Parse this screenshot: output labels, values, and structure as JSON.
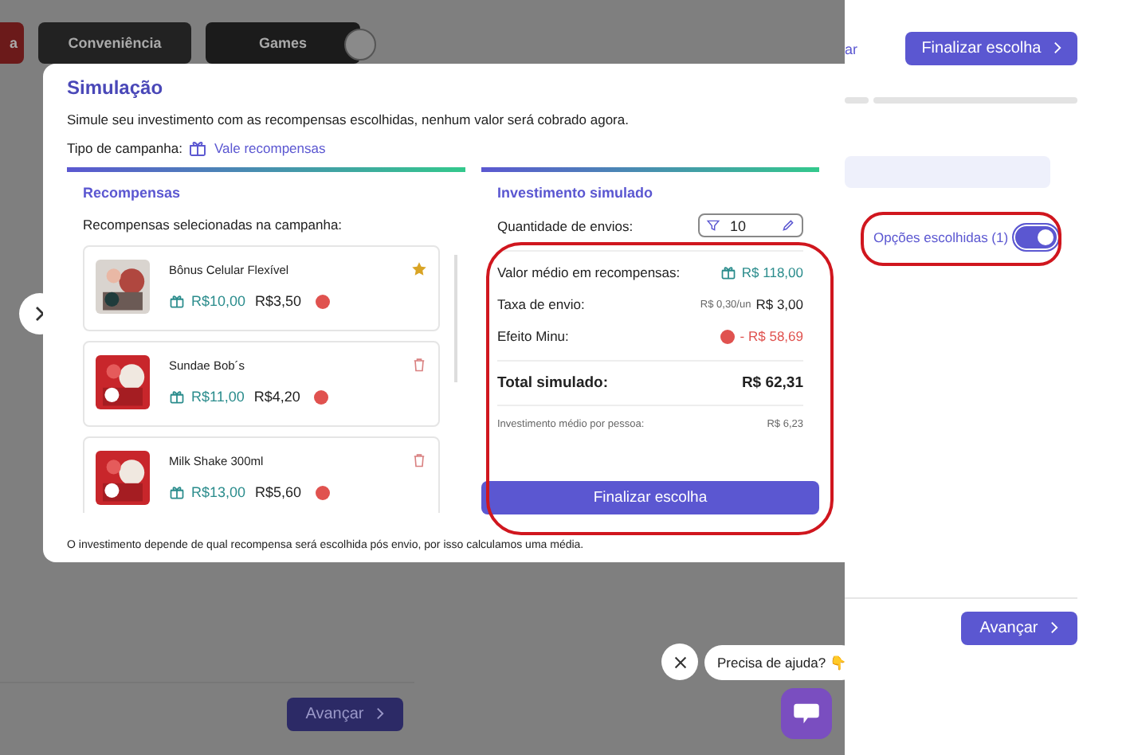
{
  "background": {
    "categories": [
      {
        "label": "a"
      },
      {
        "label": "Conveniência"
      },
      {
        "label": "Games"
      }
    ],
    "advance_button": "Avançar"
  },
  "side_panel": {
    "link": "ar",
    "finish_button": "Finalizar escolha",
    "toggle": {
      "label": "Opções escolhidas (1)",
      "on": true
    },
    "advance_button": "Avançar"
  },
  "modal": {
    "title": "Simulação",
    "subtitle": "Simule seu investimento com as recompensas escolhidas, nenhum valor será cobrado agora.",
    "campaign_type_label": "Tipo de campanha:",
    "campaign_type": "Vale recompensas",
    "rewards": {
      "title": "Recompensas",
      "caption": "Recompensas selecionadas na campanha:",
      "items": [
        {
          "name": "Bônus Celular Flexível",
          "value": "R$10,00",
          "cost": "R$3,50",
          "featured": true
        },
        {
          "name": "Sundae Bob´s",
          "value": "R$11,00",
          "cost": "R$4,20",
          "featured": false
        },
        {
          "name": "Milk Shake 300ml",
          "value": "R$13,00",
          "cost": "R$5,60",
          "featured": false
        }
      ]
    },
    "investment": {
      "title": "Investimento simulado",
      "quantity_label": "Quantidade de envios:",
      "quantity": "10",
      "rows": [
        {
          "label": "Valor médio em recompensas:",
          "value": "R$ 118,00",
          "kind": "reward"
        },
        {
          "label": "Taxa de envio:",
          "note": "R$ 0,30/un",
          "value": "R$ 3,00",
          "kind": "fee"
        },
        {
          "label": "Efeito Minu:",
          "value": "- R$ 58,69",
          "kind": "discount"
        }
      ],
      "total_label": "Total simulado:",
      "total": "R$ 62,31",
      "average_label": "Investimento médio por pessoa:",
      "average": "R$ 6,23",
      "button": "Finalizar escolha"
    },
    "footnote": "O investimento depende de qual recompensa será escolhida pós envio, por isso calculamos uma média."
  },
  "help": {
    "bubble": "Precisa de ajuda? 👇"
  }
}
